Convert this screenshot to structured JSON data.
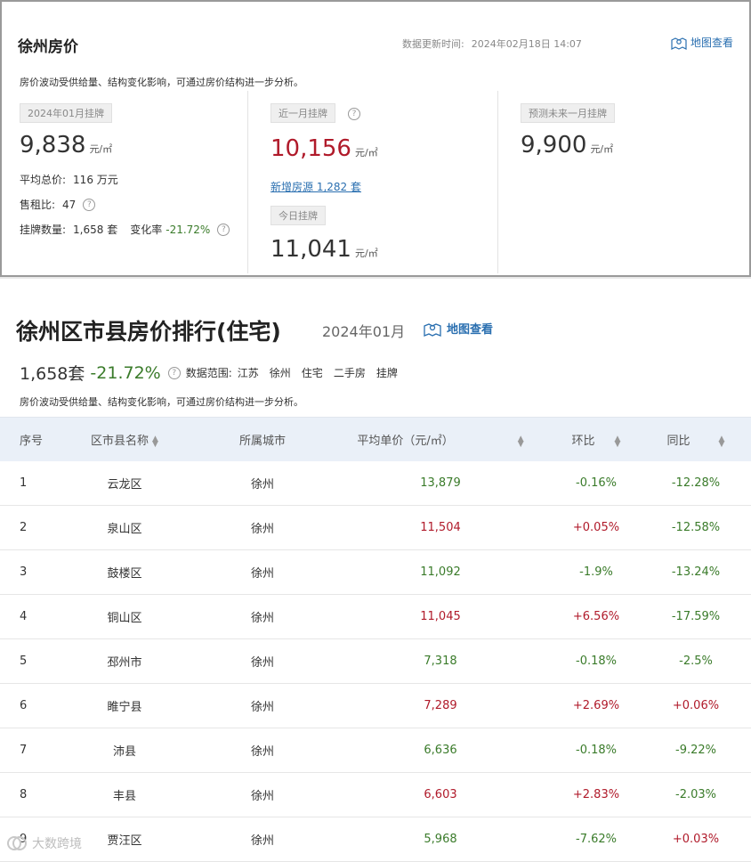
{
  "top": {
    "title": "徐州房价",
    "update_label": "数据更新时间:",
    "update_time": "2024年02月18日 14:07",
    "map_link": "地图查看",
    "description": "房价波动受供给量、结构变化影响，可通过房价结构进一步分析。",
    "col1": {
      "chip": "2024年01月挂牌",
      "price": "9,838",
      "unit": "元/㎡",
      "avg_total_label": "平均总价:",
      "avg_total_value": "116 万元",
      "rent_ratio_label": "售租比:",
      "rent_ratio_value": "47",
      "listing_label": "挂牌数量:",
      "listing_value": "1,658 套",
      "change_label": "变化率",
      "change_value": "-21.72%"
    },
    "col2": {
      "chip": "近一月挂牌",
      "price": "10,156",
      "unit": "元/㎡",
      "new_listings": "新增房源 1,282 套",
      "today_chip": "今日挂牌",
      "today_price": "11,041",
      "today_unit": "元/㎡"
    },
    "col3": {
      "chip": "预测未来一月挂牌",
      "price": "9,900",
      "unit": "元/㎡"
    }
  },
  "ranking": {
    "title": "徐州区市县房价排行(住宅)",
    "period": "2024年01月",
    "map_link": "地图查看",
    "count": "1,658套",
    "change": "-21.72%",
    "scope_label": "数据范围:",
    "scope_tags": [
      "江苏",
      "徐州",
      "住宅",
      "二手房",
      "挂牌"
    ],
    "description": "房价波动受供给量、结构变化影响，可通过房价结构进一步分析。",
    "columns": [
      "序号",
      "区市县名称",
      "所属城市",
      "平均单价（元/㎡）",
      "环比",
      "同比"
    ],
    "rows": [
      {
        "no": "1",
        "name": "云龙区",
        "city": "徐州",
        "price": "13,879",
        "price_color": "green",
        "mom": "-0.16%",
        "mom_color": "green",
        "yoy": "-12.28%",
        "yoy_color": "green"
      },
      {
        "no": "2",
        "name": "泉山区",
        "city": "徐州",
        "price": "11,504",
        "price_color": "red",
        "mom": "+0.05%",
        "mom_color": "red",
        "yoy": "-12.58%",
        "yoy_color": "green"
      },
      {
        "no": "3",
        "name": "鼓楼区",
        "city": "徐州",
        "price": "11,092",
        "price_color": "green",
        "mom": "-1.9%",
        "mom_color": "green",
        "yoy": "-13.24%",
        "yoy_color": "green"
      },
      {
        "no": "4",
        "name": "铜山区",
        "city": "徐州",
        "price": "11,045",
        "price_color": "red",
        "mom": "+6.56%",
        "mom_color": "red",
        "yoy": "-17.59%",
        "yoy_color": "green"
      },
      {
        "no": "5",
        "name": "邳州市",
        "city": "徐州",
        "price": "7,318",
        "price_color": "green",
        "mom": "-0.18%",
        "mom_color": "green",
        "yoy": "-2.5%",
        "yoy_color": "green"
      },
      {
        "no": "6",
        "name": "睢宁县",
        "city": "徐州",
        "price": "7,289",
        "price_color": "red",
        "mom": "+2.69%",
        "mom_color": "red",
        "yoy": "+0.06%",
        "yoy_color": "red"
      },
      {
        "no": "7",
        "name": "沛县",
        "city": "徐州",
        "price": "6,636",
        "price_color": "green",
        "mom": "-0.18%",
        "mom_color": "green",
        "yoy": "-9.22%",
        "yoy_color": "green"
      },
      {
        "no": "8",
        "name": "丰县",
        "city": "徐州",
        "price": "6,603",
        "price_color": "red",
        "mom": "+2.83%",
        "mom_color": "red",
        "yoy": "-2.03%",
        "yoy_color": "green"
      },
      {
        "no": "9",
        "name": "贾汪区",
        "city": "徐州",
        "price": "5,968",
        "price_color": "green",
        "mom": "-7.62%",
        "mom_color": "green",
        "yoy": "+0.03%",
        "yoy_color": "red"
      }
    ]
  },
  "watermark": "大数跨境",
  "colors": {
    "green": "#3a7b2a",
    "red": "#b01a2a",
    "link": "#2a6fb0",
    "header_bg": "#eaf0f8"
  }
}
